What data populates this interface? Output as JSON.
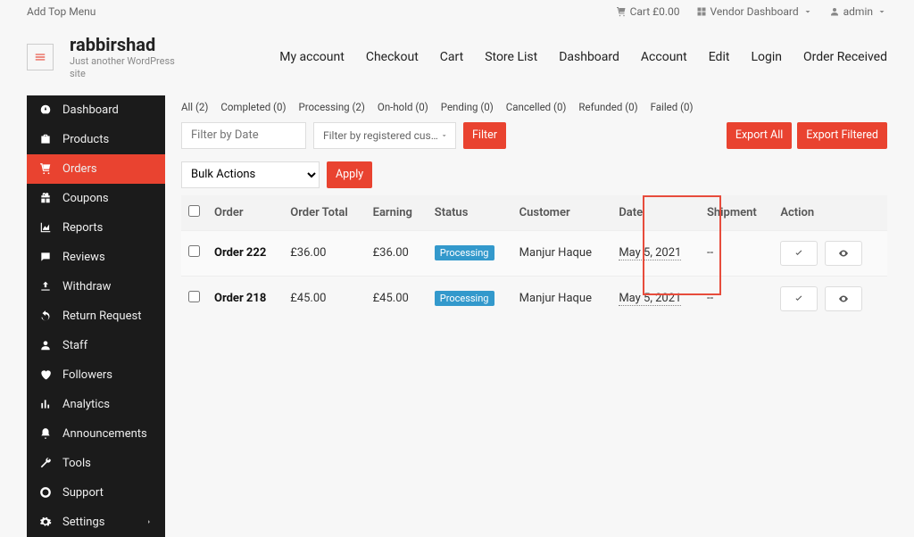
{
  "top": {
    "left_menu": "Add Top Menu",
    "cart": "Cart £0.00",
    "vendor_dashboard": "Vendor Dashboard",
    "admin": "admin"
  },
  "site": {
    "name": "rabbirshad",
    "tagline": "Just another WordPress site"
  },
  "nav": {
    "my_account": "My account",
    "checkout": "Checkout",
    "cart": "Cart",
    "store_list": "Store List",
    "dashboard": "Dashboard",
    "account": "Account",
    "edit": "Edit",
    "login": "Login",
    "order_received": "Order Received"
  },
  "sidebar": {
    "dashboard": "Dashboard",
    "products": "Products",
    "orders": "Orders",
    "coupons": "Coupons",
    "reports": "Reports",
    "reviews": "Reviews",
    "withdraw": "Withdraw",
    "return_request": "Return Request",
    "staff": "Staff",
    "followers": "Followers",
    "analytics": "Analytics",
    "announcements": "Announcements",
    "tools": "Tools",
    "support": "Support",
    "settings": "Settings"
  },
  "tabs": {
    "all": "All (2)",
    "completed": "Completed (0)",
    "processing": "Processing (2)",
    "onhold": "On-hold (0)",
    "pending": "Pending (0)",
    "cancelled": "Cancelled (0)",
    "refunded": "Refunded (0)",
    "failed": "Failed (0)"
  },
  "filters": {
    "date_placeholder": "Filter by Date",
    "customer_placeholder": "Filter by registered custo…",
    "filter_btn": "Filter",
    "export_all": "Export All",
    "export_filtered": "Export Filtered"
  },
  "bulk": {
    "select": "Bulk Actions",
    "apply": "Apply"
  },
  "table": {
    "headers": {
      "order": "Order",
      "order_total": "Order Total",
      "earning": "Earning",
      "status": "Status",
      "customer": "Customer",
      "date": "Date",
      "shipment": "Shipment",
      "action": "Action"
    },
    "rows": [
      {
        "order": "Order 222",
        "total": "£36.00",
        "earning": "£36.00",
        "status": "Processing",
        "customer": "Manjur Haque",
        "date": "May 5, 2021",
        "shipment": "--"
      },
      {
        "order": "Order 218",
        "total": "£45.00",
        "earning": "£45.00",
        "status": "Processing",
        "customer": "Manjur Haque",
        "date": "May 5, 2021",
        "shipment": "--"
      }
    ]
  }
}
